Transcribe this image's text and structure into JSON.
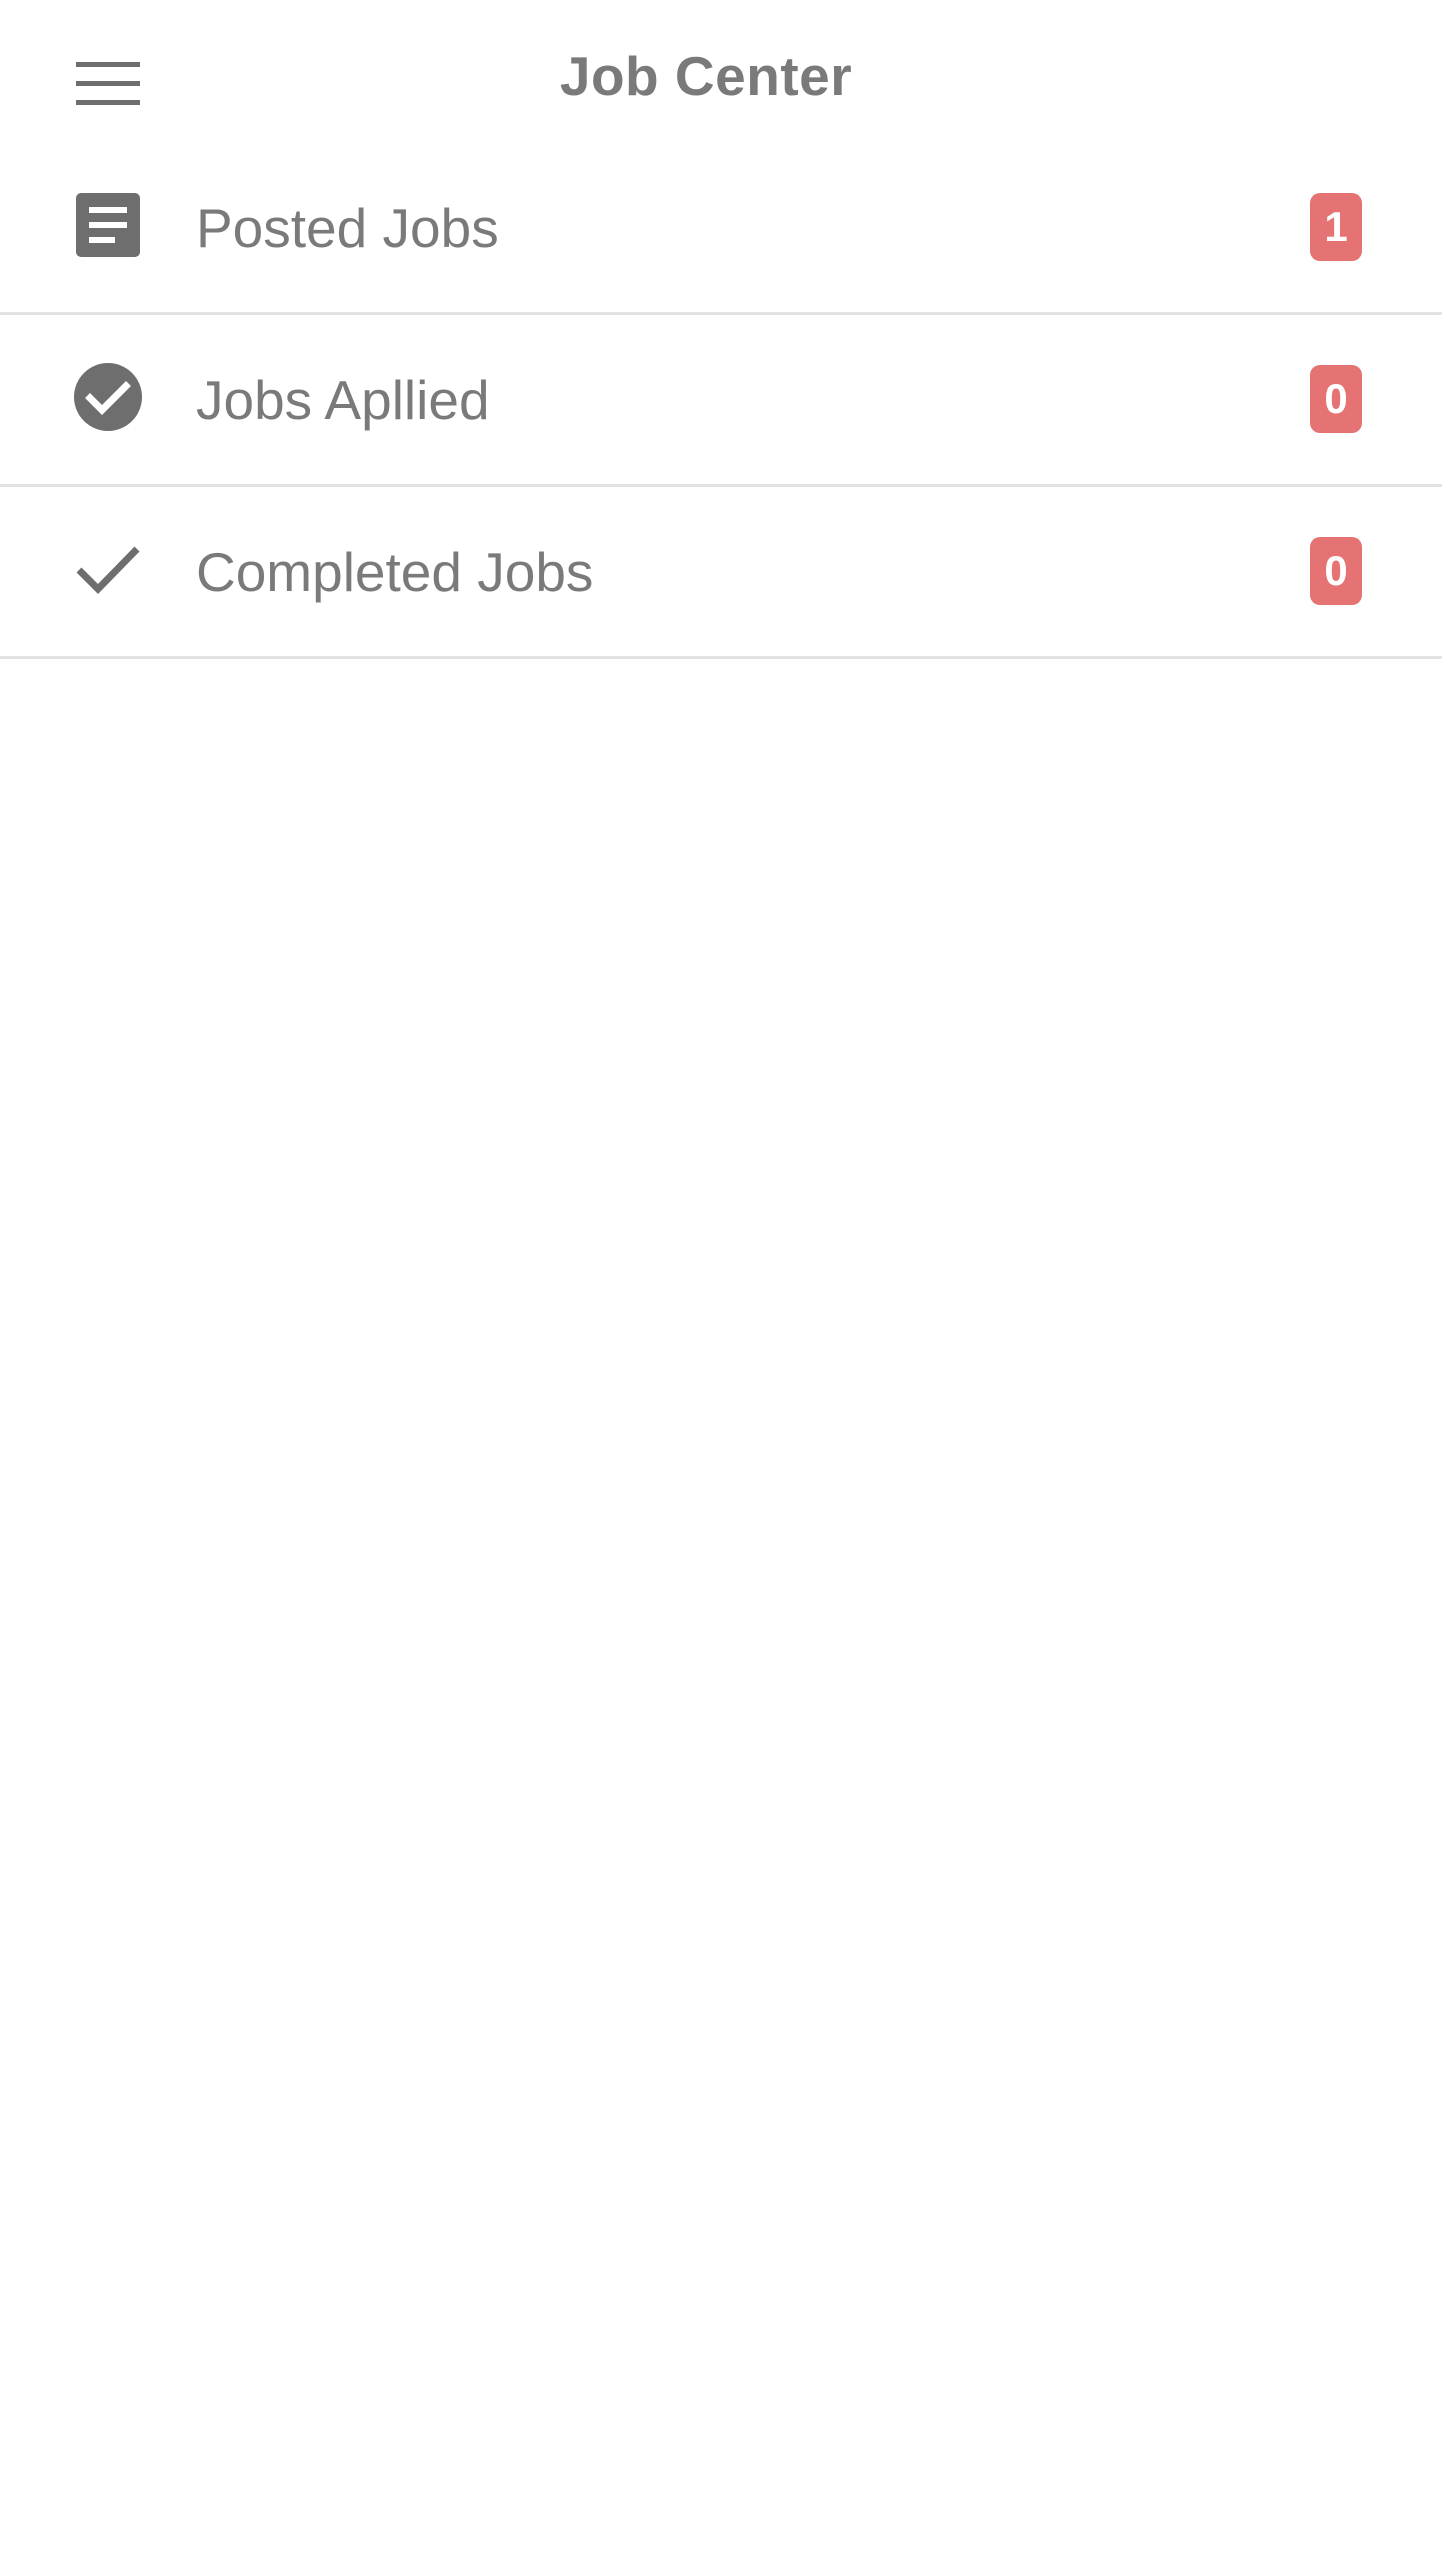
{
  "header": {
    "title": "Job Center",
    "menu_icon": "hamburger-menu-icon"
  },
  "jobs": {
    "items": [
      {
        "label": "Posted Jobs",
        "count": "1",
        "icon": "document-icon"
      },
      {
        "label": "Jobs Apllied",
        "count": "0",
        "icon": "check-circle-icon"
      },
      {
        "label": "Completed Jobs",
        "count": "0",
        "icon": "checkmark-icon"
      }
    ]
  },
  "colors": {
    "badge": "#e57373",
    "text": "#7a7a7a",
    "icon": "#6e6e6e",
    "divider": "#e2e2e2",
    "background": "#ffffff"
  }
}
